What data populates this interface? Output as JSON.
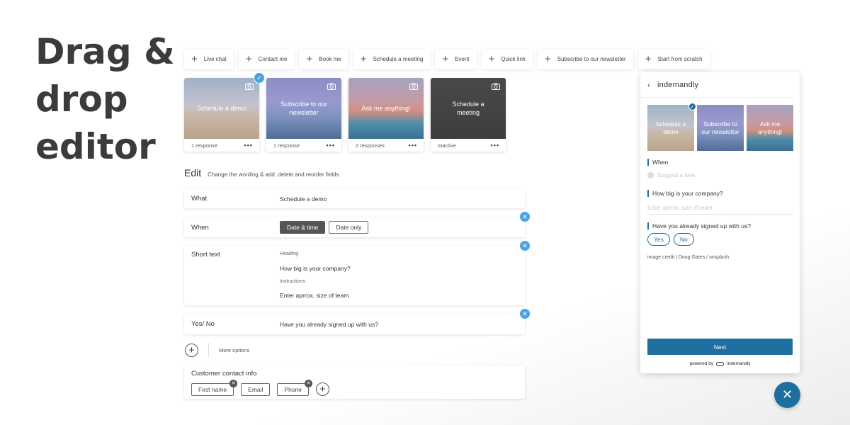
{
  "headline": [
    "Drag &",
    "drop",
    "editor"
  ],
  "toolbar": [
    "Live chat",
    "Contact me",
    "Book me",
    "Schedule a meeting",
    "Event",
    "Quick link",
    "Subscribe to our newsletter",
    "Start from scratch"
  ],
  "cards": [
    {
      "title": "Schedule a demo",
      "footer": "1 response",
      "selected": true
    },
    {
      "title": "Subscribe to our newsletter",
      "footer": "1 response",
      "selected": false
    },
    {
      "title": "Ask me anything!",
      "footer": "2 responses",
      "selected": false
    },
    {
      "title": "Schedule a meeting",
      "footer": "Inactive",
      "selected": false
    }
  ],
  "card_menu_icon": "•••",
  "edit": {
    "title": "Edit",
    "subtitle": "Change the wording & add, delete and reorder fields",
    "what_label": "What",
    "what_value": "Schedule a demo",
    "when_label": "When",
    "when_options": [
      "Date & time",
      "Date only"
    ],
    "short_label": "Short text",
    "heading_label": "Heading",
    "heading_value": "How big is your company?",
    "instructions_label": "Instructions",
    "instructions_value": "Enter aprrox. size of team",
    "yesno_label": "Yes/ No",
    "yesno_value": "Have you already signed up  with us?",
    "more_options": "More options",
    "contact_title": "Customer contact info",
    "contact_fields": [
      "First name",
      "Email",
      "Phone"
    ]
  },
  "preview": {
    "brand": "indemandly",
    "mini_cards": [
      "Schedule a demo",
      "Subscribe to our newsletter",
      "Ask me anything!"
    ],
    "q_when": "When",
    "suggest": "Suggest a time",
    "q_size": "How big is your company?",
    "size_placeholder": "Enter aprrox. size of team",
    "q_signed": "Have you already signed up with us?",
    "yes": "Yes",
    "no": "No",
    "credit": "image credit | Doug Gates / unsplash",
    "next": "Next",
    "powered_by": "powered by",
    "powered_brand": "indemandly"
  },
  "colors": {
    "accent": "#1f6ea0",
    "badge": "#4aa3e6"
  },
  "icons": {
    "plus": "+",
    "close": "✕",
    "check": "✓",
    "back": "‹"
  }
}
